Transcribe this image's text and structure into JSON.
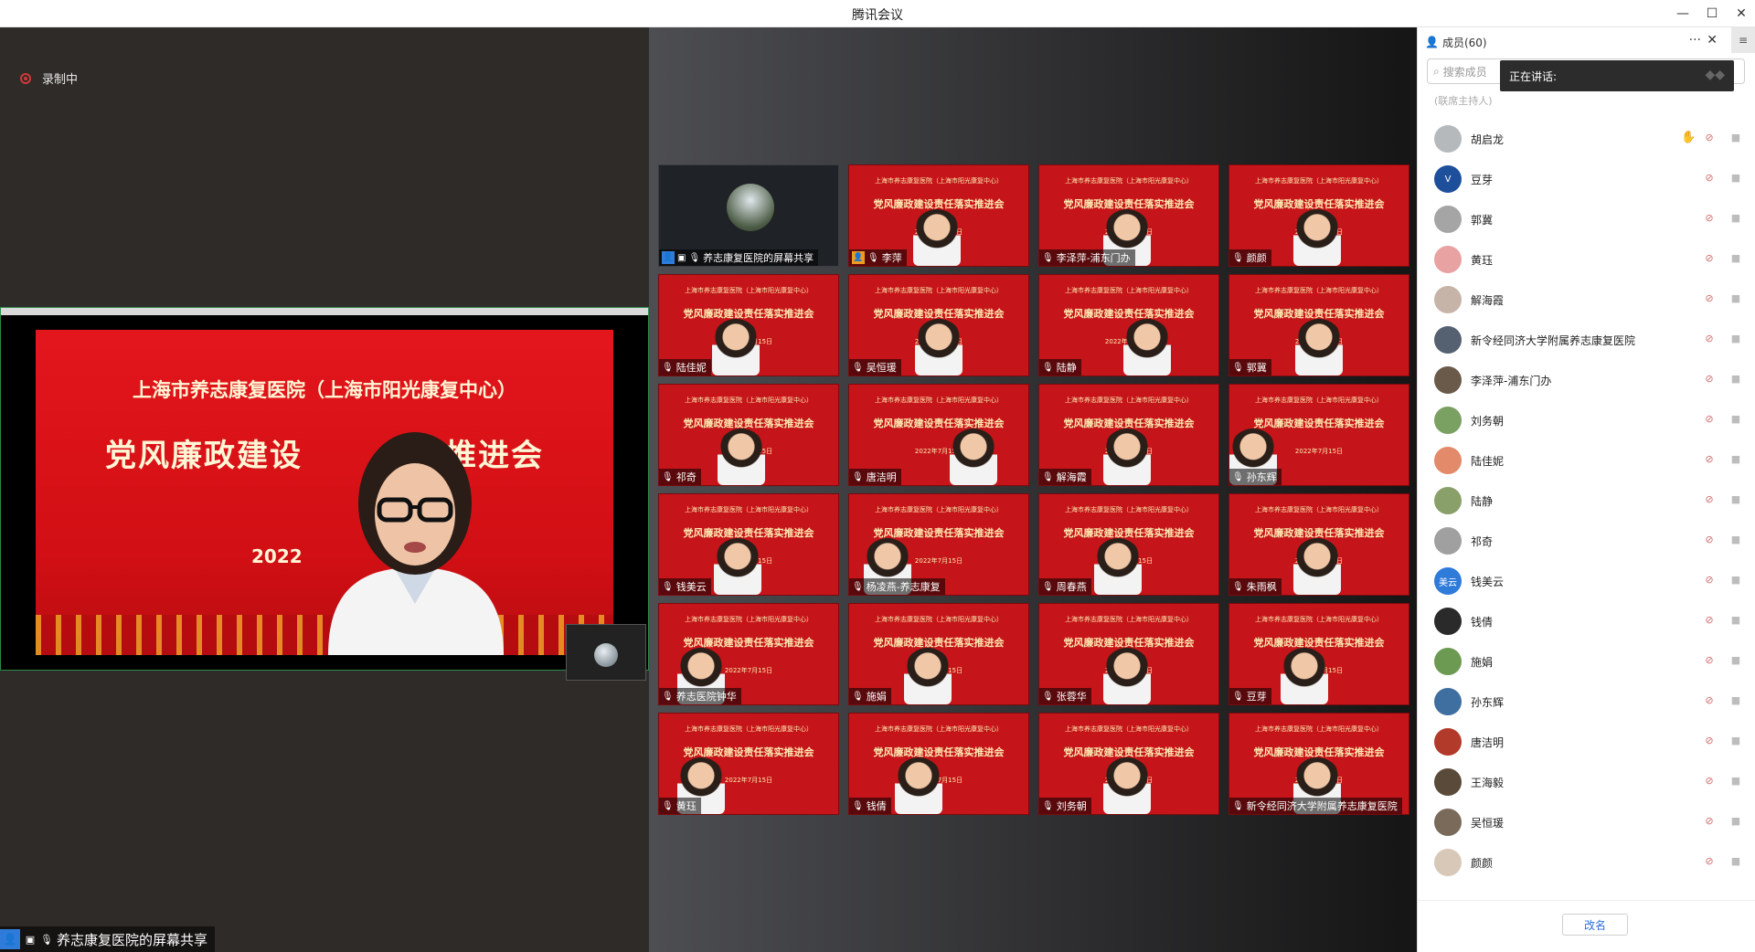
{
  "window": {
    "title": "腾讯会议"
  },
  "left": {
    "recording": "录制中",
    "share": {
      "slide_org": "上海市养志康复医院（上海市阳光康复中心）",
      "slide_title": "党风廉政建设",
      "slide_title_tail": "实推进会",
      "slide_year": "2022",
      "bottom_name": "养志康复医院的屏幕共享"
    }
  },
  "grid": {
    "slide_org_small": "上海市养志康复医院（上海市阳光康复中心）",
    "slide_title_small": "党风廉政建设责任落实推进会",
    "slide_date": "2022年7月15日",
    "tiles": [
      {
        "name": "养志康复医院的屏幕共享"
      },
      {
        "name": "李萍"
      },
      {
        "name": "李泽萍-浦东门办"
      },
      {
        "name": "颜颜"
      },
      {
        "name": "陆佳妮"
      },
      {
        "name": "吴恒瑗"
      },
      {
        "name": "陆静"
      },
      {
        "name": "郭冀"
      },
      {
        "name": "祁奇"
      },
      {
        "name": "唐洁明"
      },
      {
        "name": "解海霞"
      },
      {
        "name": "孙东辉"
      },
      {
        "name": "钱美云"
      },
      {
        "name": "杨凌燕-养志康复"
      },
      {
        "name": "周春燕"
      },
      {
        "name": "朱雨枫"
      },
      {
        "name": "养志医院钟华"
      },
      {
        "name": "施娟"
      },
      {
        "name": "张蓉华"
      },
      {
        "name": "豆芽"
      },
      {
        "name": "黄珏"
      },
      {
        "name": "钱倩"
      },
      {
        "name": "刘务朝"
      },
      {
        "name": "新令经同济大学附属养志康复医院"
      }
    ]
  },
  "panel": {
    "title": "成员(60)",
    "search_placeholder": "搜索成员",
    "speaking": "正在讲话:",
    "partial_row": "(联席主持人)",
    "rename_label": "改名",
    "members": [
      {
        "name": "胡启龙",
        "hand": true
      },
      {
        "name": "豆芽",
        "avatar_text": "V"
      },
      {
        "name": "郭冀"
      },
      {
        "name": "黄珏"
      },
      {
        "name": "解海霞"
      },
      {
        "name": "新令经同济大学附属养志康复医院"
      },
      {
        "name": "李泽萍-浦东门办"
      },
      {
        "name": "刘务朝"
      },
      {
        "name": "陆佳妮"
      },
      {
        "name": "陆静"
      },
      {
        "name": "祁奇"
      },
      {
        "name": "钱美云",
        "avatar_text": "美云"
      },
      {
        "name": "钱倩"
      },
      {
        "name": "施娟"
      },
      {
        "name": "孙东辉"
      },
      {
        "name": "唐洁明"
      },
      {
        "name": "王海毅"
      },
      {
        "name": "吴恒瑗"
      },
      {
        "name": "颜颜"
      }
    ]
  },
  "colors": {
    "accent": "#2f6fd9",
    "slide_red": "#d10f14",
    "mute_red": "#d46a6a"
  }
}
